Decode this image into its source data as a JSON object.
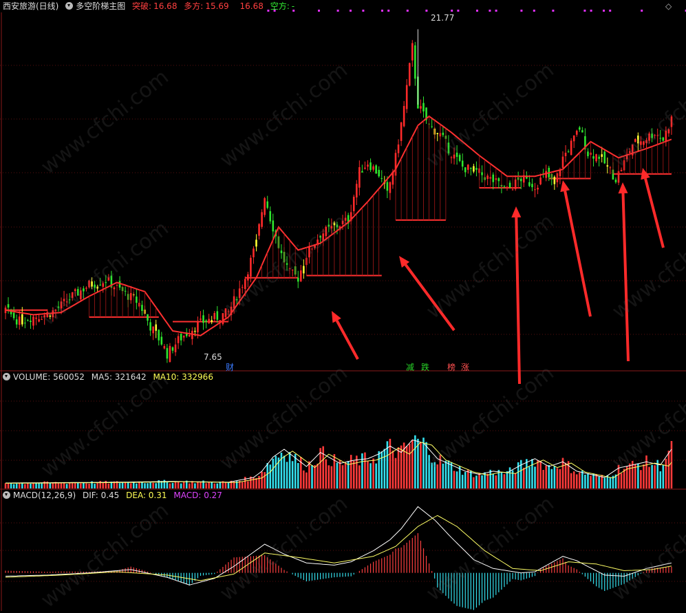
{
  "header": {
    "stock": "西安旅游(日线)",
    "indicator": "多空阶梯主图",
    "tupo_label": "突破:",
    "tupo_value": "16.68",
    "duofang_label": "多方:",
    "duofang_value": "15.69",
    "value3": "16.68",
    "kongfang_label": "空方:",
    "kongfang_value": "-"
  },
  "volume_header": {
    "label": "VOLUME: 560052",
    "ma5": "MA5: 321642",
    "ma10": "MA10: 332966"
  },
  "macd_header": {
    "label": "MACD(12,26,9)",
    "dif": "DIF: 0.45",
    "dea": "DEA: 0.31",
    "macd": "MACD: 0.27"
  },
  "annotations": {
    "high": "21.77",
    "low": "7.65",
    "events": [
      {
        "text": "财",
        "color": "#3a7bff"
      },
      {
        "text": "减",
        "color": "#28d228"
      },
      {
        "text": "跌",
        "color": "#28d228"
      },
      {
        "text": "榜",
        "color": "#ff5050"
      },
      {
        "text": "涨",
        "color": "#ff5050"
      }
    ]
  },
  "watermark": "www.cfchi.com",
  "icons": [
    "dropdown-circle-icon",
    "diamond-icon"
  ],
  "colors": {
    "up": "#ff2a2a",
    "down": "#2ee62e",
    "signal": "#ffff33",
    "step_line": "#ff3030",
    "vol_cyan": "#34e0ee",
    "ma10": "#ffff66",
    "macd_purple": "#dd33ff"
  },
  "chart_data": {
    "type": "candlestick",
    "title": "西安旅游(日线)",
    "price_range": [
      7.0,
      22.5
    ],
    "volume_range": [
      0,
      700000
    ],
    "macd_range": [
      -1.6,
      3.2
    ],
    "grid": true,
    "anchors": [
      [
        0,
        9.6
      ],
      [
        5,
        9.1
      ],
      [
        9,
        9.3
      ],
      [
        14,
        9.4
      ],
      [
        18,
        9.6
      ],
      [
        24,
        10.2
      ],
      [
        30,
        10.7
      ],
      [
        36,
        10.9
      ],
      [
        42,
        10.4
      ],
      [
        48,
        9.9
      ],
      [
        52,
        8.9
      ],
      [
        56,
        8.2
      ],
      [
        58,
        7.7
      ],
      [
        62,
        8.3
      ],
      [
        67,
        8.8
      ],
      [
        71,
        9.1
      ],
      [
        76,
        9.3
      ],
      [
        80,
        9.5
      ],
      [
        86,
        11.0
      ],
      [
        90,
        12.5
      ],
      [
        93,
        14.6
      ],
      [
        95,
        13.6
      ],
      [
        97,
        12.8
      ],
      [
        99,
        12.0
      ],
      [
        102,
        11.2
      ],
      [
        105,
        11.0
      ],
      [
        108,
        12.0
      ],
      [
        113,
        12.9
      ],
      [
        118,
        13.2
      ],
      [
        123,
        13.5
      ],
      [
        127,
        15.6
      ],
      [
        130,
        16.0
      ],
      [
        134,
        15.5
      ],
      [
        137,
        14.6
      ],
      [
        140,
        16.2
      ],
      [
        143,
        18.4
      ],
      [
        146,
        21.0
      ],
      [
        148,
        18.5
      ],
      [
        152,
        17.6
      ],
      [
        156,
        17.2
      ],
      [
        160,
        16.4
      ],
      [
        164,
        15.8
      ],
      [
        169,
        15.6
      ],
      [
        175,
        15.2
      ],
      [
        180,
        14.8
      ],
      [
        185,
        15.3
      ],
      [
        190,
        15.0
      ],
      [
        194,
        15.5
      ],
      [
        197,
        15.0
      ],
      [
        200,
        16.2
      ],
      [
        204,
        17.0
      ],
      [
        206,
        17.5
      ],
      [
        209,
        16.4
      ],
      [
        213,
        16.3
      ],
      [
        216,
        15.8
      ],
      [
        219,
        15.3
      ],
      [
        222,
        16.0
      ],
      [
        225,
        16.8
      ],
      [
        229,
        17.0
      ],
      [
        233,
        17.3
      ],
      [
        236,
        17.0
      ],
      [
        239,
        17.9
      ]
    ],
    "ma10_anchors": [
      [
        0,
        9.6
      ],
      [
        10,
        9.4
      ],
      [
        20,
        9.5
      ],
      [
        30,
        10.2
      ],
      [
        40,
        10.8
      ],
      [
        50,
        10.4
      ],
      [
        60,
        8.7
      ],
      [
        70,
        8.5
      ],
      [
        80,
        9.3
      ],
      [
        90,
        11.0
      ],
      [
        98,
        13.2
      ],
      [
        105,
        12.2
      ],
      [
        113,
        12.5
      ],
      [
        123,
        13.4
      ],
      [
        130,
        14.3
      ],
      [
        140,
        15.7
      ],
      [
        148,
        17.6
      ],
      [
        152,
        18.0
      ],
      [
        160,
        17.3
      ],
      [
        170,
        16.3
      ],
      [
        180,
        15.4
      ],
      [
        190,
        15.4
      ],
      [
        200,
        15.7
      ],
      [
        210,
        16.9
      ],
      [
        220,
        16.2
      ],
      [
        230,
        16.6
      ],
      [
        239,
        17.0
      ]
    ],
    "volume_anchors": [
      [
        0,
        35000
      ],
      [
        40,
        40000
      ],
      [
        60,
        45000
      ],
      [
        80,
        40000
      ],
      [
        89,
        70000
      ],
      [
        92,
        110000
      ],
      [
        96,
        200000
      ],
      [
        100,
        250000
      ],
      [
        108,
        140000
      ],
      [
        113,
        230000
      ],
      [
        120,
        160000
      ],
      [
        125,
        180000
      ],
      [
        130,
        190000
      ],
      [
        134,
        220000
      ],
      [
        138,
        270000
      ],
      [
        142,
        230000
      ],
      [
        146,
        310000
      ],
      [
        150,
        290000
      ],
      [
        155,
        190000
      ],
      [
        160,
        150000
      ],
      [
        165,
        110000
      ],
      [
        170,
        90000
      ],
      [
        175,
        110000
      ],
      [
        180,
        100000
      ],
      [
        185,
        150000
      ],
      [
        190,
        190000
      ],
      [
        195,
        140000
      ],
      [
        200,
        170000
      ],
      [
        205,
        110000
      ],
      [
        210,
        90000
      ],
      [
        215,
        70000
      ],
      [
        220,
        130000
      ],
      [
        225,
        150000
      ],
      [
        230,
        170000
      ],
      [
        235,
        150000
      ],
      [
        239,
        250000
      ]
    ],
    "dif_anchors": [
      [
        0,
        -0.15
      ],
      [
        15,
        -0.1
      ],
      [
        30,
        0.0
      ],
      [
        45,
        0.15
      ],
      [
        58,
        -0.2
      ],
      [
        66,
        -0.55
      ],
      [
        75,
        -0.25
      ],
      [
        82,
        0.3
      ],
      [
        93,
        1.3
      ],
      [
        100,
        0.85
      ],
      [
        108,
        0.45
      ],
      [
        118,
        0.35
      ],
      [
        124,
        0.5
      ],
      [
        132,
        1.0
      ],
      [
        138,
        1.5
      ],
      [
        142,
        2.0
      ],
      [
        148,
        3.0
      ],
      [
        154,
        2.4
      ],
      [
        160,
        1.6
      ],
      [
        168,
        0.6
      ],
      [
        175,
        0.2
      ],
      [
        185,
        0.0
      ],
      [
        190,
        0.05
      ],
      [
        200,
        0.75
      ],
      [
        205,
        0.55
      ],
      [
        215,
        -0.1
      ],
      [
        222,
        -0.15
      ],
      [
        230,
        0.2
      ],
      [
        239,
        0.45
      ]
    ],
    "dea_anchors": [
      [
        0,
        -0.2
      ],
      [
        20,
        -0.1
      ],
      [
        40,
        0.05
      ],
      [
        58,
        -0.1
      ],
      [
        70,
        -0.35
      ],
      [
        82,
        -0.05
      ],
      [
        93,
        0.9
      ],
      [
        105,
        0.7
      ],
      [
        118,
        0.45
      ],
      [
        132,
        0.75
      ],
      [
        140,
        1.2
      ],
      [
        148,
        2.1
      ],
      [
        155,
        2.6
      ],
      [
        162,
        2.1
      ],
      [
        172,
        1.0
      ],
      [
        182,
        0.2
      ],
      [
        192,
        0.1
      ],
      [
        202,
        0.5
      ],
      [
        212,
        0.4
      ],
      [
        222,
        0.1
      ],
      [
        232,
        0.15
      ],
      [
        239,
        0.31
      ]
    ]
  }
}
